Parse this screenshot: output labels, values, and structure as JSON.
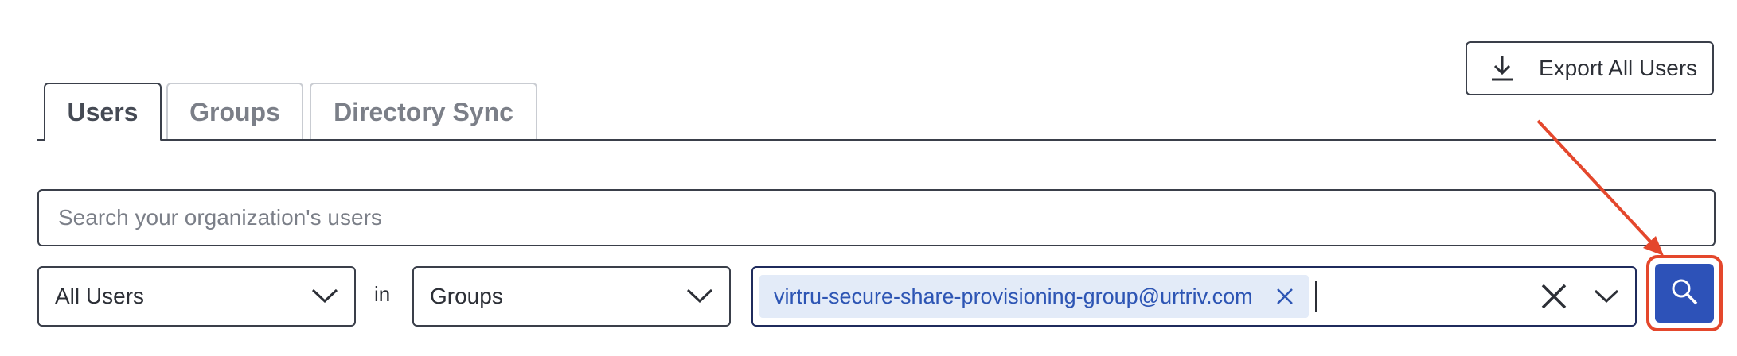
{
  "header": {
    "export_label": "Export All Users",
    "export_icon": "download-icon"
  },
  "tabs": [
    {
      "label": "Users",
      "active": true
    },
    {
      "label": "Groups",
      "active": false
    },
    {
      "label": "Directory Sync",
      "active": false
    }
  ],
  "search": {
    "placeholder": "Search your organization's users",
    "value": ""
  },
  "filters": {
    "scope_value": "All Users",
    "in_label": "in",
    "field_value": "Groups",
    "selected_tags": [
      "virtru-secure-share-provisioning-group@urtriv.com"
    ]
  },
  "search_button": {
    "icon": "search-icon"
  },
  "colors": {
    "accent": "#2d52b8",
    "tag_bg": "#e3ebf8",
    "tag_text": "#2d55b4",
    "annotation": "#e4472c",
    "border": "#3a3f4a"
  }
}
